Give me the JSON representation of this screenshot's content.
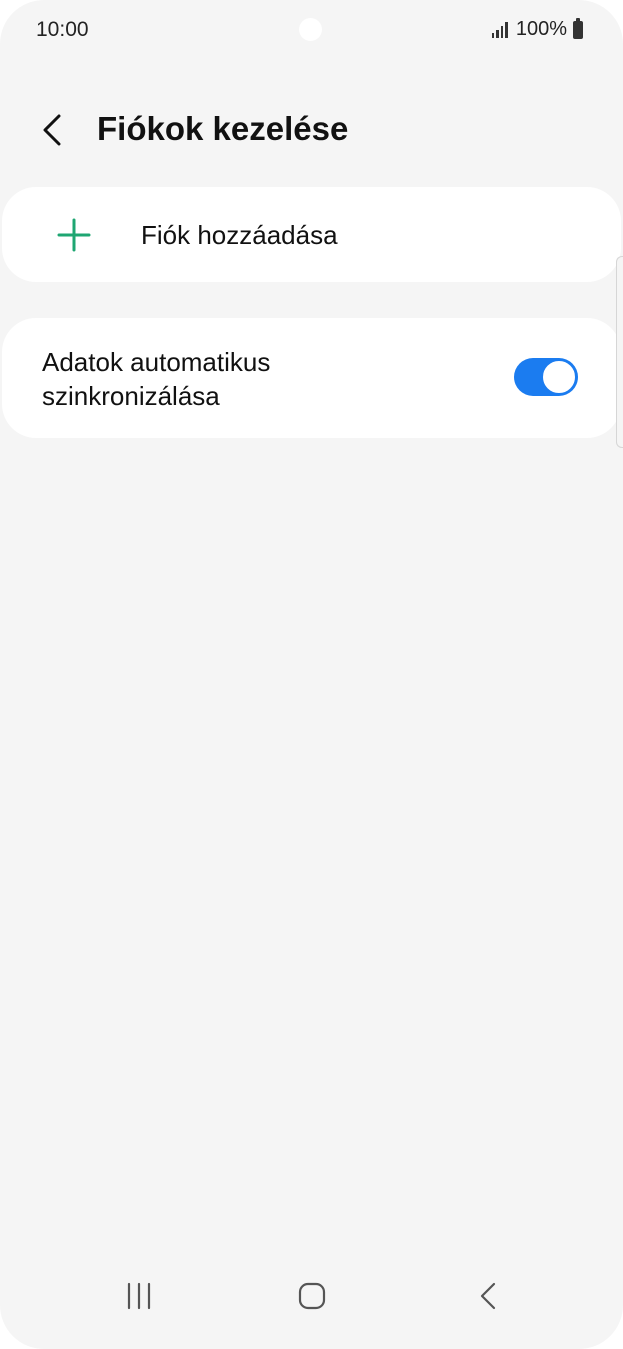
{
  "status_bar": {
    "time": "10:00",
    "battery_percent": "100%",
    "icons": [
      "signal-icon",
      "battery-icon"
    ]
  },
  "header": {
    "title": "Fiókok kezelése",
    "back_icon": "chevron-left-icon"
  },
  "add_account": {
    "label": "Fiók hozzáadása",
    "icon": "plus-icon",
    "icon_color": "#1ea672"
  },
  "auto_sync": {
    "label": "Adatok automatikus szinkronizálása",
    "enabled": true,
    "accent_color": "#1b7cf0"
  },
  "nav_bar": {
    "icons": [
      "recents-icon",
      "home-icon",
      "back-icon"
    ]
  },
  "colors": {
    "background": "#f5f5f5",
    "card": "#ffffff",
    "text": "#111111"
  }
}
